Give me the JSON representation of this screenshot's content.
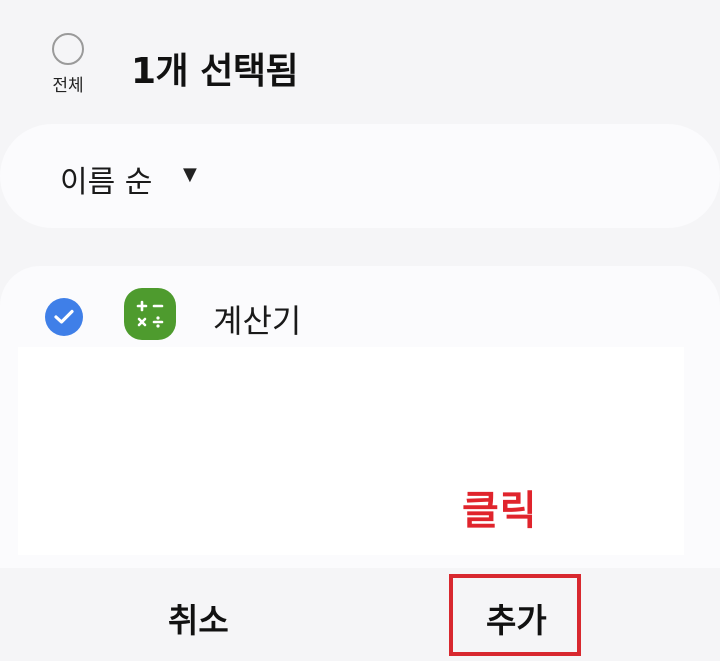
{
  "header": {
    "select_all_label": "전체",
    "selected_count": "1개 선택됨"
  },
  "sort": {
    "label": "이름 순",
    "caret": "▼"
  },
  "list": {
    "items": [
      {
        "name": "계산기",
        "checked": true,
        "icon": "calculator-icon"
      }
    ]
  },
  "annotation": {
    "text": "클릭",
    "color": "#e0242c"
  },
  "bottom_bar": {
    "cancel_label": "취소",
    "add_label": "추가"
  },
  "colors": {
    "check": "#3f7fe8",
    "calculator_icon": "#4e9b2e",
    "highlight_box": "#d8282f"
  }
}
